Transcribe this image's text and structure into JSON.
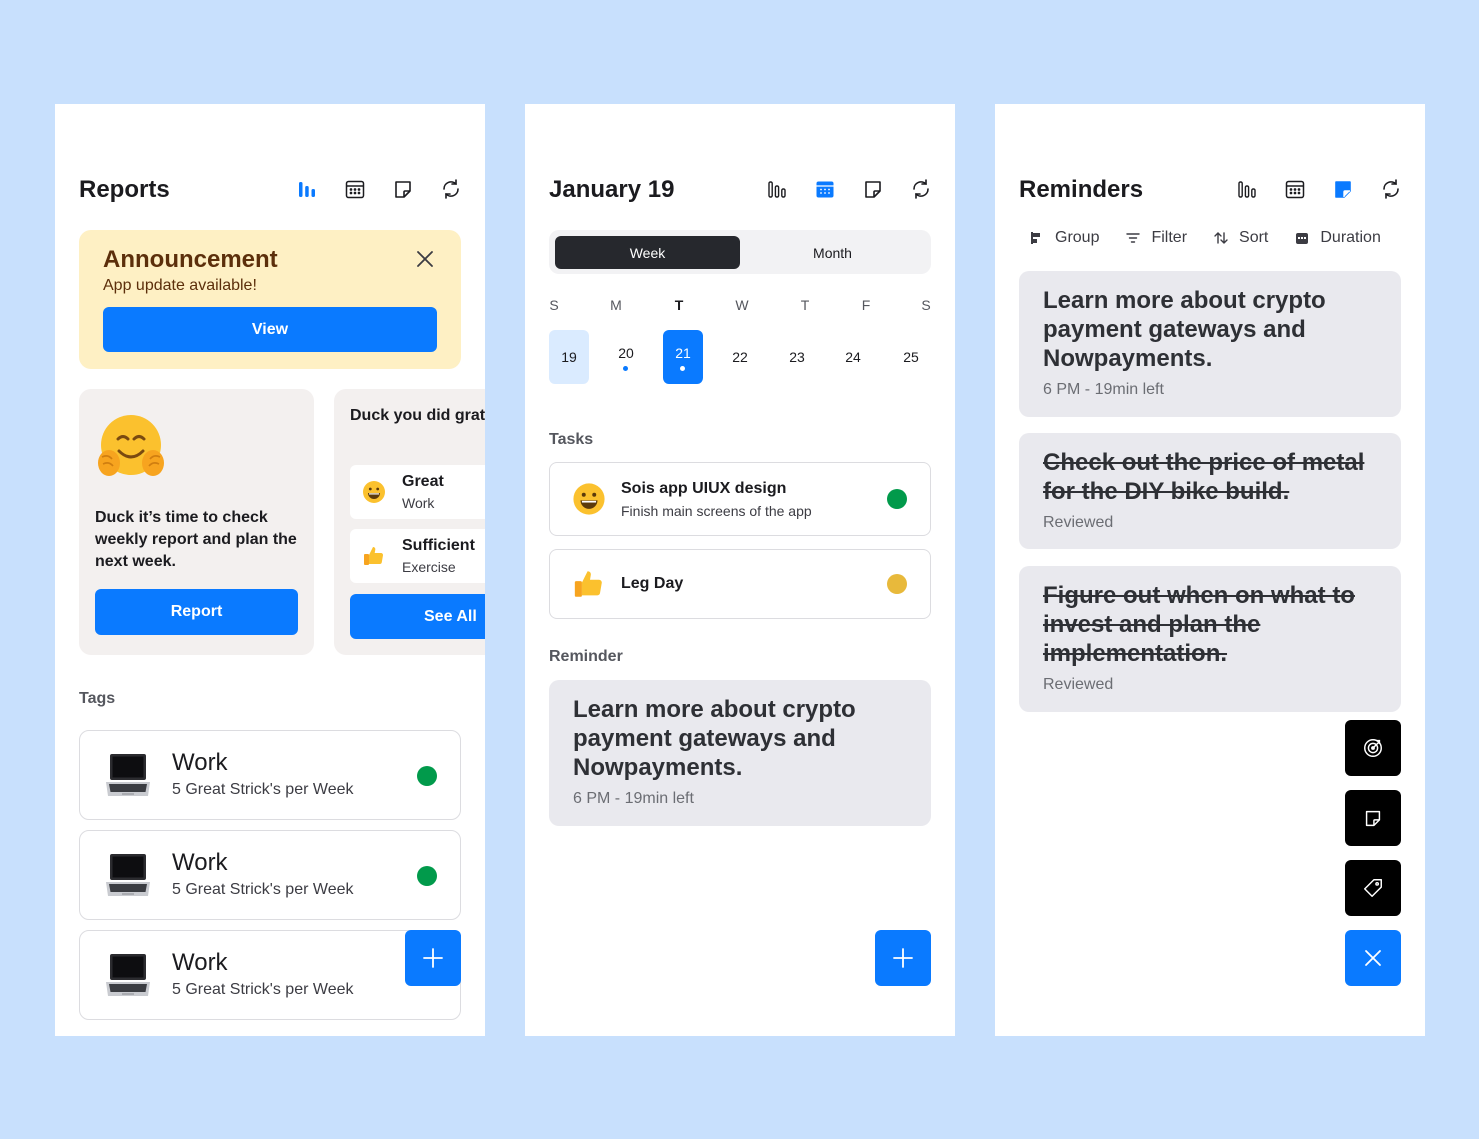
{
  "colors": {
    "accent": "#0A7AFF",
    "green": "#019A4B",
    "yellow": "#E8B93B",
    "background": "#C8E0FD"
  },
  "reports": {
    "title": "Reports",
    "header_icons": [
      "bar-chart-icon",
      "calendar-icon",
      "note-icon",
      "refresh-icon"
    ],
    "announcement": {
      "title": "Announcement",
      "subtitle": "App update available!",
      "button": "View"
    },
    "check_card": {
      "text": "Duck it’s time to check weekly report and plan the next week.",
      "button": "Report"
    },
    "summary_card": {
      "text": "Duck you did grat yesterday",
      "items": [
        {
          "title": "Great",
          "subtitle": "Work",
          "icon": "grinning-face-emoji"
        },
        {
          "title": "Sufficient",
          "subtitle": "Exercise",
          "icon": "thumbs-up-emoji"
        }
      ],
      "button": "See All"
    },
    "tags_label": "Tags",
    "tags": [
      {
        "title": "Work",
        "subtitle": "5 Great Strick's per Week",
        "status": "green"
      },
      {
        "title": "Work",
        "subtitle": "5 Great Strick's per Week",
        "status": "green"
      },
      {
        "title": "Work",
        "subtitle": "5 Great Strick's per Week",
        "status": ""
      }
    ]
  },
  "calendar": {
    "title": "January 19",
    "tabs": {
      "week": "Week",
      "month": "Month"
    },
    "days_of_week": [
      "S",
      "M",
      "T",
      "W",
      "T",
      "F",
      "S"
    ],
    "dates": [
      "19",
      "20",
      "21",
      "22",
      "23",
      "24",
      "25"
    ],
    "tasks_label": "Tasks",
    "tasks": [
      {
        "title": "Sois app UIUX design",
        "subtitle": "Finish main screens of the app",
        "status": "green"
      },
      {
        "title": "Leg Day",
        "subtitle": "",
        "status": "yellow"
      }
    ],
    "reminder_label": "Reminder",
    "reminder": {
      "title": "Learn more about crypto payment gateways and Nowpayments.",
      "meta": "6 PM - 19min left"
    }
  },
  "reminders": {
    "title": "Reminders",
    "toolbar": {
      "group": "Group",
      "filter": "Filter",
      "sort": "Sort",
      "duration": "Duration"
    },
    "items": [
      {
        "title": "Learn more about crypto payment gateways and Nowpayments.",
        "meta": "6 PM - 19min left",
        "done": false
      },
      {
        "title": "Check out the price of metal for the DIY bike build.",
        "meta": "Reviewed",
        "done": true
      },
      {
        "title": "Figure out when on what to invest and plan the implementation.",
        "meta": "Reviewed",
        "done": true
      }
    ],
    "fab_menu": [
      "target-icon",
      "note-icon",
      "tag-icon",
      "close-icon"
    ]
  }
}
